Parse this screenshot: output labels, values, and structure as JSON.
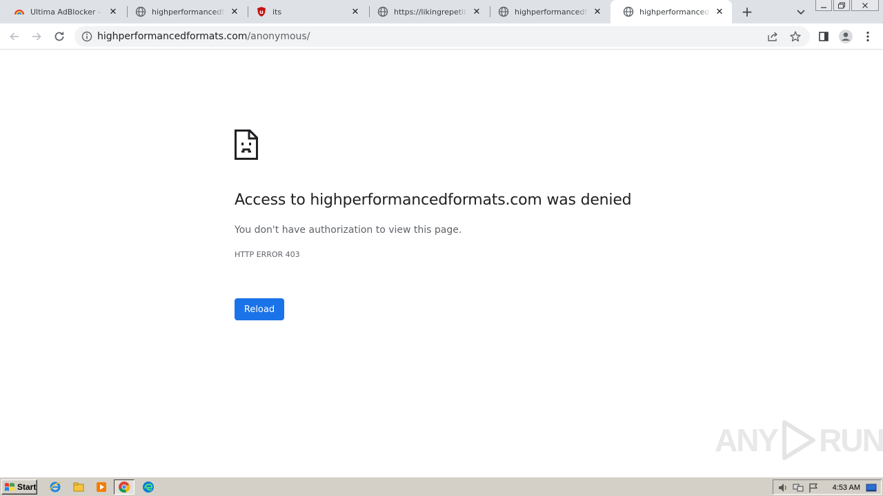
{
  "tabs": [
    {
      "title": "Ultima AdBlocker - The b",
      "favicon": "rainbow-icon",
      "active": false
    },
    {
      "title": "highperformancedformats",
      "favicon": "globe-icon",
      "active": false
    },
    {
      "title": "its",
      "favicon": "ublock-shield-icon",
      "active": false
    },
    {
      "title": "https://likingrepetitious",
      "favicon": "globe-icon",
      "active": false
    },
    {
      "title": "highperformancedformats",
      "favicon": "globe-icon",
      "active": false
    },
    {
      "title": "highperformancedformats",
      "favicon": "globe-icon",
      "active": true
    }
  ],
  "omnibox": {
    "host": "highperformancedformats.com",
    "path": "/anonymous/"
  },
  "error_page": {
    "title": "Access to highperformancedformats.com was denied",
    "description": "You don't have authorization to view this page.",
    "code": "HTTP ERROR 403",
    "reload_label": "Reload"
  },
  "watermark": {
    "left": "ANY",
    "right": "RUN"
  },
  "taskbar": {
    "start_label": "Start",
    "clock": "4:53 AM"
  },
  "colors": {
    "tabstrip_bg": "#dee1e6",
    "accent_button": "#1a73e8",
    "taskbar_bg": "#d4d0c8"
  }
}
